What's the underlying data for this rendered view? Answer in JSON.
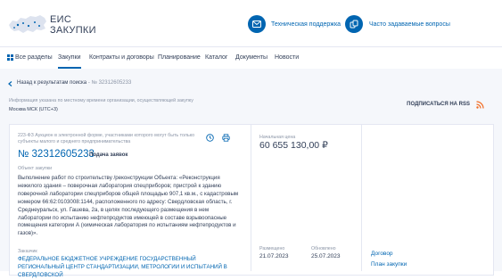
{
  "header": {
    "logo_line1": "ЕИС",
    "logo_line2": "ЗАКУПКИ",
    "support_label": "Техническая поддержка",
    "faq_label": "Часто задаваемые вопросы"
  },
  "nav": {
    "items": [
      {
        "label": "Все разделы"
      },
      {
        "label": "Закупки"
      },
      {
        "label": "Контракты и договоры"
      },
      {
        "label": "Планирование"
      },
      {
        "label": "Каталог"
      },
      {
        "label": "Документы"
      },
      {
        "label": "Новости"
      }
    ],
    "active_index": 1
  },
  "breadcrumb": {
    "back": "Назад к результатам поиска",
    "separator": "-",
    "current": "№ 32312605233"
  },
  "info": {
    "note": "Информация указана по местному времени организации, осуществляющей закупку",
    "timezone": "Москва МСК (UTC+3)",
    "rss": "ПОДПИСАТЬСЯ НА RSS"
  },
  "card": {
    "law": "223-ФЗ Аукцион в электронной форме, участниками которого могут быть только субъекты малого и среднего предпринимательства",
    "number": "№ 32312605233",
    "stage": "Подача заявок",
    "object_label": "Объект закупки",
    "object_text": "Выполнение работ по строительству /реконструкции Объекта: «Реконструкция нежилого здания – поверочная лаборатория спецприборов; пристрой к зданию поверочной лаборатории спецприборов общей площадью 907,1 кв.м., с кадастровым номером 66:62:0103008:1144, расположенного по адресу: Свердловская область, г. Среднеуральск, ул. Гашева, 2а, в целях последующего размещения в нем лаборатории по испытанию нефтепродуктов имеющей в составе взрывоопасные помещения категории А (химическая лаборатория по испытаниям нефтепродуктов и газов)».",
    "org_label": "Заказчик",
    "org_text": "ФЕДЕРАЛЬНОЕ БЮДЖЕТНОЕ УЧРЕЖДЕНИЕ ГОСУДАРСТВЕННЫЙ РЕГИОНАЛЬНЫЙ ЦЕНТР СТАНДАРТИЗАЦИИ, МЕТРОЛОГИИ И ИСПЫТАНИЙ В СВЕРДЛОВСКОЙ",
    "price_label": "Начальная цена",
    "price": "60 655 130,00 ₽",
    "placed_label": "Размещено",
    "placed": "21.07.2023",
    "updated_label": "Обновлено",
    "updated": "25.07.2023",
    "links": [
      "Договор",
      "План закупки"
    ]
  },
  "colors": {
    "accent": "#0065b1",
    "text": "#334059",
    "muted": "#8a94a6",
    "rss": "#f26b21"
  }
}
